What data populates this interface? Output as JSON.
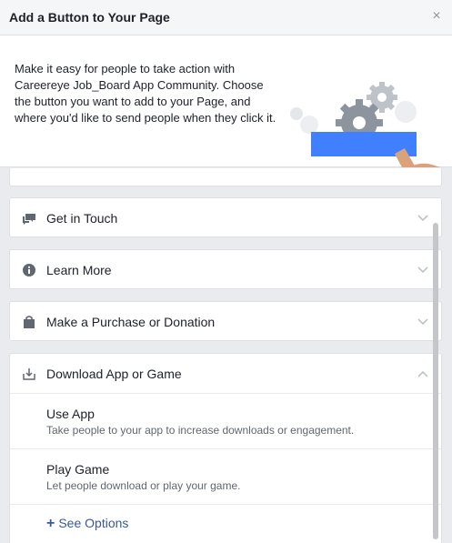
{
  "header": {
    "title": "Add a Button to Your Page",
    "close_glyph": "×"
  },
  "intro": {
    "text": "Make it easy for people to take action with Careereye Job_Board App Community. Choose the button you want to add to your Page, and where you'd like to send people when they click it.",
    "illustration_colors": {
      "button": "#4080ff",
      "gear_dark": "#8d949e",
      "gear_light": "#bec3c9",
      "hand": "#d9a27a"
    }
  },
  "categories": [
    {
      "label": "Get in Touch",
      "icon": "chat-icon"
    },
    {
      "label": "Learn More",
      "icon": "info-icon"
    },
    {
      "label": "Make a Purchase or Donation",
      "icon": "shopping-bag-icon"
    }
  ],
  "expanded": {
    "label": "Download App or Game",
    "icon": "download-icon",
    "options": [
      {
        "title": "Use App",
        "description": "Take people to your app to increase downloads or engagement."
      },
      {
        "title": "Play Game",
        "description": "Let people download or play your game."
      }
    ],
    "see_options": "See Options",
    "see_options_glyph": "+"
  },
  "colors": {
    "link": "#385898",
    "icon": "#606770",
    "chevron": "#bec3c9"
  }
}
